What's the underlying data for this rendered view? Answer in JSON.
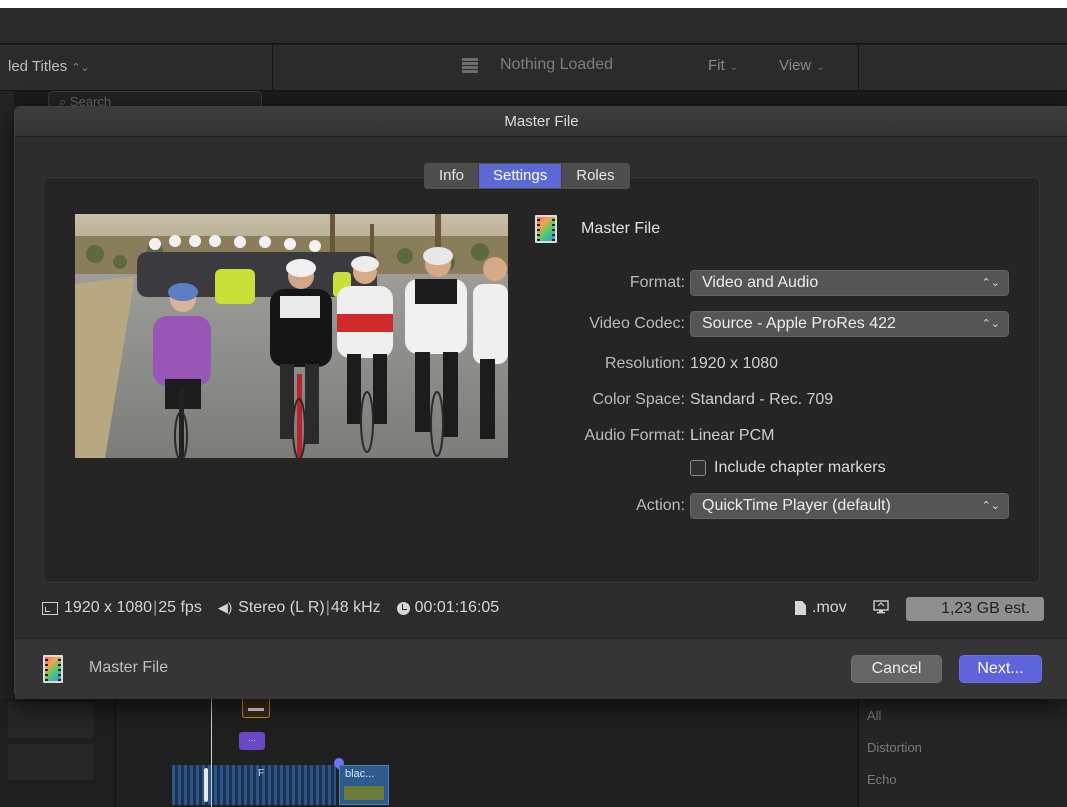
{
  "background": {
    "browser_title": "led Titles",
    "viewer_status": "Nothing Loaded",
    "fit_label": "Fit",
    "view_label": "View",
    "search_placeholder": "Search",
    "timeline": {
      "clip_label": "blac...",
      "clip_f": "F",
      "purple_clip": "...",
      "effects_categories": [
        "All",
        "Distortion",
        "Echo"
      ]
    }
  },
  "dialog": {
    "title": "Master File",
    "tabs": [
      {
        "label": "Info",
        "active": false
      },
      {
        "label": "Settings",
        "active": true
      },
      {
        "label": "Roles",
        "active": false
      }
    ],
    "destination_name": "Master File",
    "settings": {
      "format_label": "Format:",
      "format_value": "Video and Audio",
      "video_codec_label": "Video Codec:",
      "video_codec_value": "Source - Apple ProRes 422",
      "resolution_label": "Resolution:",
      "resolution_value": "1920 x 1080",
      "color_space_label": "Color Space:",
      "color_space_value": "Standard - Rec. 709",
      "audio_format_label": "Audio Format:",
      "audio_format_value": "Linear PCM",
      "chapter_markers_label": "Include chapter markers",
      "chapter_markers_checked": false,
      "action_label": "Action:",
      "action_value": "QuickTime Player (default)"
    },
    "summary": {
      "resolution": "1920 x 1080",
      "fps": "25 fps",
      "audio_channels": "Stereo (L R)",
      "sample_rate": "48 kHz",
      "duration": "00:01:16:05",
      "file_extension": ".mov",
      "size_estimate": "1,23 GB est."
    },
    "footer": {
      "destination_name": "Master File",
      "cancel_label": "Cancel",
      "next_label": "Next..."
    }
  },
  "colors": {
    "accent": "#5d63da",
    "active_tab": "#5c68d4",
    "sheet_background": "#2c2c2c"
  },
  "icons": {
    "destination": "film-strip-gradient-icon",
    "summary_frame": "frame-size-icon",
    "summary_audio": "speaker-icon",
    "summary_duration": "clock-icon",
    "file": "document-icon",
    "monitor": "monitor-icon"
  }
}
